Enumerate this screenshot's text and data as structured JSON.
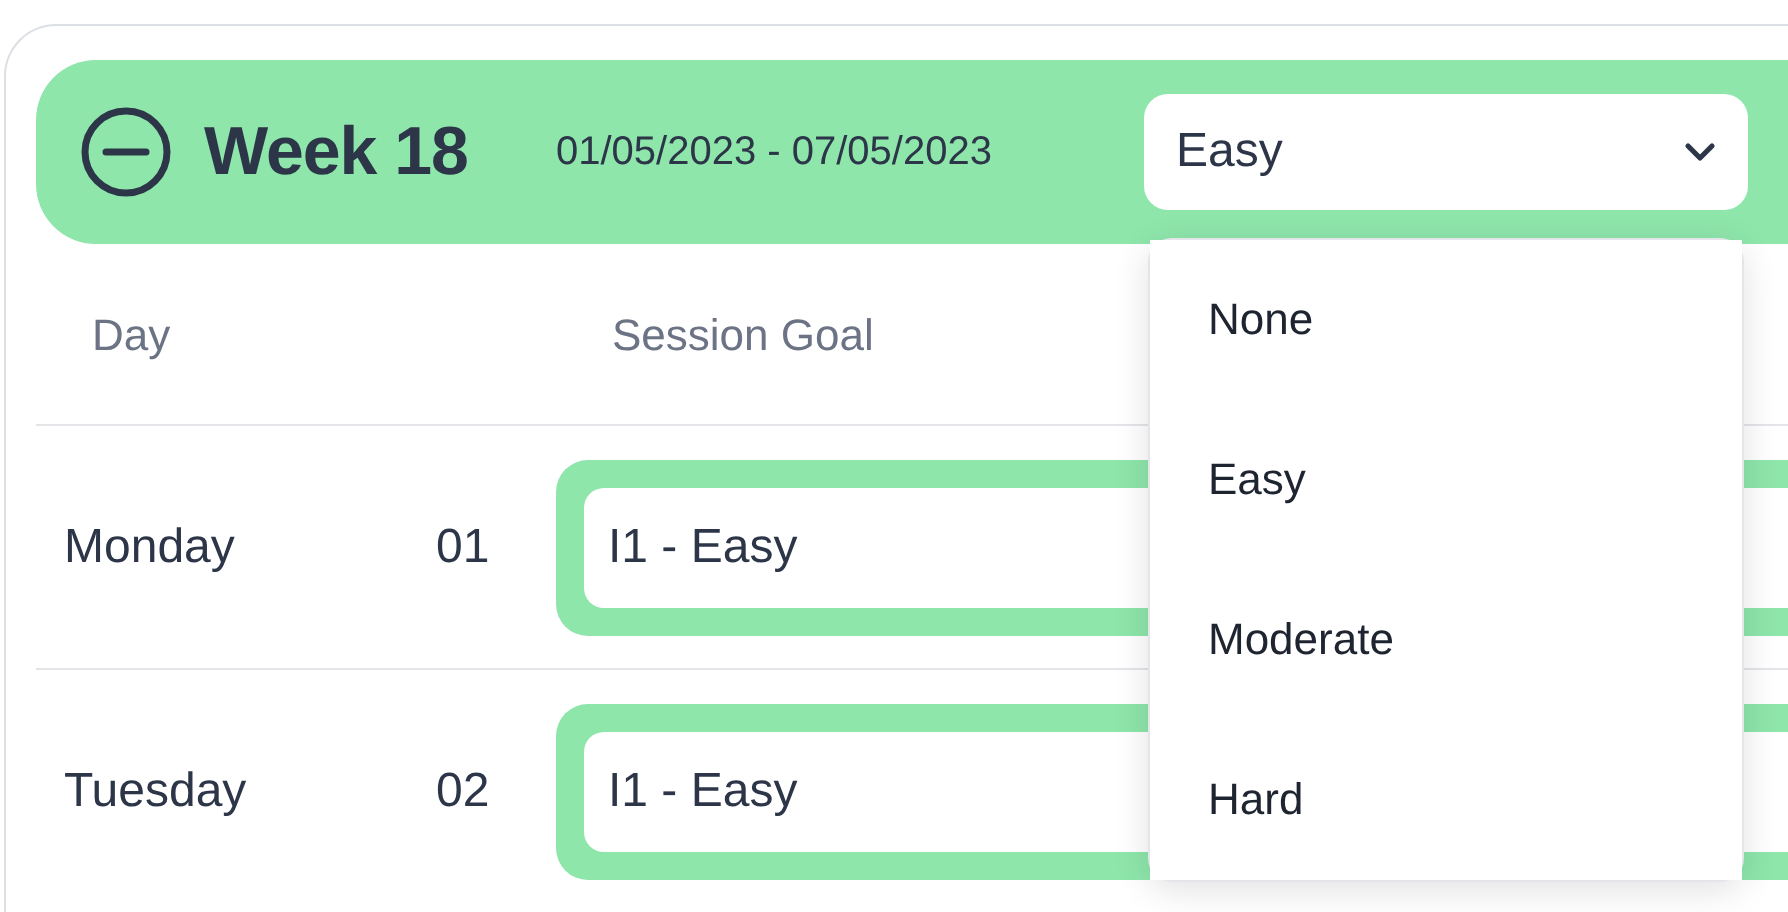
{
  "week": {
    "expanded": true,
    "title": "Week 18",
    "date_range": "01/05/2023 - 07/05/2023",
    "difficulty": {
      "value": "Easy",
      "open": true,
      "options": [
        "None",
        "Easy",
        "Moderate",
        "Hard"
      ]
    }
  },
  "table": {
    "columns": [
      "Day",
      "Session Goal"
    ],
    "rows": [
      {
        "day": "Monday",
        "number": "01",
        "session_goal": "I1 - Easy"
      },
      {
        "day": "Tuesday",
        "number": "02",
        "session_goal": "I1 - Easy"
      }
    ]
  }
}
